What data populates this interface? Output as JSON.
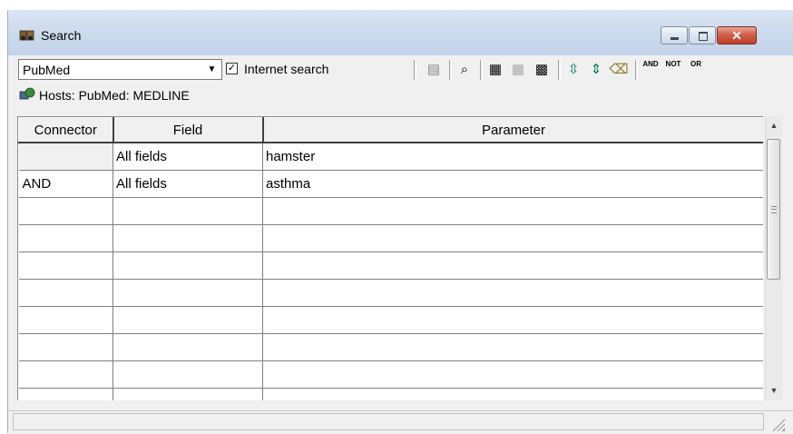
{
  "window": {
    "title": "Search",
    "controls": {
      "minimize": "–",
      "maximize": "□",
      "close": "✕"
    }
  },
  "toolbar": {
    "database_select": {
      "value": "PubMed",
      "arrow": "▼"
    },
    "internet_search": {
      "checked": true,
      "check_mark": "✓",
      "label": "Internet search"
    },
    "buttons": [
      {
        "icon": "document-icon",
        "glyph": "▤"
      },
      {
        "icon": "binoculars-search-icon",
        "glyph": "⌕"
      },
      {
        "icon": "search-documents-icon",
        "glyph": "▦"
      },
      {
        "icon": "search-documents-disabled-icon",
        "glyph": "▦"
      },
      {
        "icon": "numbered-list-icon",
        "glyph": "▩"
      },
      {
        "icon": "insert-row-icon",
        "glyph": "⇳"
      },
      {
        "icon": "delete-row-icon",
        "glyph": "⇕"
      },
      {
        "icon": "eraser-icon",
        "glyph": "⌫"
      },
      {
        "icon": "and-operator-icon",
        "label": "AND"
      },
      {
        "icon": "not-operator-icon",
        "label": "NOT"
      },
      {
        "icon": "or-operator-icon",
        "label": "OR"
      }
    ]
  },
  "hosts": {
    "label": "Hosts:  PubMed: MEDLINE",
    "icon": "hosts-icon"
  },
  "grid": {
    "columns": [
      "Connector",
      "Field",
      "Parameter"
    ],
    "rows": [
      [
        "",
        "All fields",
        "hamster"
      ],
      [
        "AND",
        "All fields",
        "asthma"
      ],
      [
        "",
        "",
        ""
      ],
      [
        "",
        "",
        ""
      ],
      [
        "",
        "",
        ""
      ],
      [
        "",
        "",
        ""
      ],
      [
        "",
        "",
        ""
      ],
      [
        "",
        "",
        ""
      ],
      [
        "",
        "",
        ""
      ],
      [
        "",
        "",
        ""
      ]
    ]
  },
  "scrollbar": {
    "up": "▲",
    "down": "▼"
  },
  "colors": {
    "title_bar": "#c2d3ea",
    "close_button": "#c0402a",
    "grid_lines": "#808080",
    "window_background": "#f0f0f0"
  }
}
